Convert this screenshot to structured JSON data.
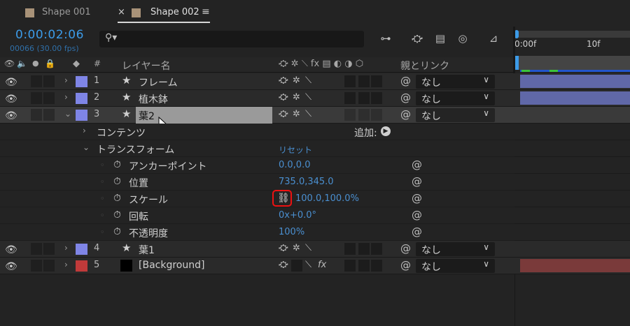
{
  "tabs": [
    {
      "label": "Shape 001",
      "active": false
    },
    {
      "label": "Shape 002",
      "active": true
    }
  ],
  "timecode": "0:00:02:06",
  "framecount": "00066 (30.00 fps)",
  "search": {
    "placeholder": "",
    "icon": "search-icon"
  },
  "ruler": {
    "labels": [
      "0:00f",
      "10f"
    ]
  },
  "headers": {
    "layer_name": "レイヤー名",
    "num": "#",
    "parent": "親とリンク"
  },
  "layers": [
    {
      "num": "1",
      "name": "フレーム",
      "color": "#7f85e6",
      "parent": "なし",
      "fill": "#6068a8"
    },
    {
      "num": "2",
      "name": "植木鉢",
      "color": "#7f85e6",
      "parent": "なし",
      "fill": "#6068a8"
    },
    {
      "num": "3",
      "name": "葉2",
      "color": "#7f85e6",
      "parent": "なし",
      "selected": true
    }
  ],
  "contents_label": "コンテンツ",
  "add_label": "追加:",
  "transform_label": "トランスフォーム",
  "reset_label": "リセット",
  "properties": [
    {
      "label": "アンカーポイント",
      "value": "0.0,0.0"
    },
    {
      "label": "位置",
      "value": "735.0,345.0"
    },
    {
      "label": "スケール",
      "value": "100.0,100.0%"
    },
    {
      "label": "回転",
      "value": "0x+0.0°"
    },
    {
      "label": "不透明度",
      "value": "100%"
    }
  ],
  "layers_bottom": [
    {
      "num": "4",
      "name": "葉1",
      "color": "#7f85e6",
      "parent": "なし"
    },
    {
      "num": "5",
      "name": "[Background]",
      "color": "#c03a3a",
      "parent": "なし",
      "fill": "#7a3a3a"
    }
  ],
  "colors": {
    "accent": "#3c9be8",
    "value_blue": "#4a8fd0",
    "highlight_red": "#e11"
  }
}
